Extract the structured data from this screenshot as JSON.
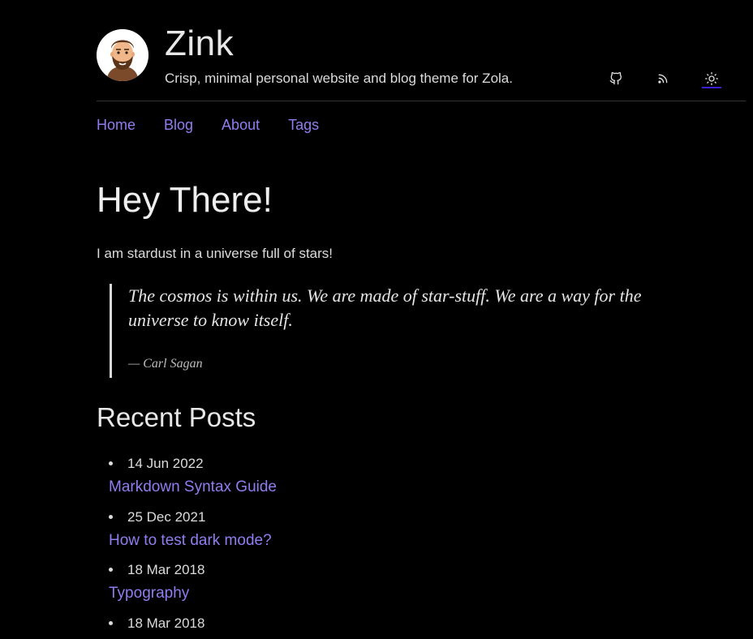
{
  "header": {
    "title": "Zink",
    "tagline": "Crisp, minimal personal website and blog theme for Zola.",
    "icons": [
      "github-icon",
      "rss-icon",
      "sun-icon"
    ],
    "accent_color": "#3b1ed6"
  },
  "nav": {
    "items": [
      {
        "label": "Home"
      },
      {
        "label": "Blog"
      },
      {
        "label": "About"
      },
      {
        "label": "Tags"
      }
    ],
    "link_color": "#8f7ef0"
  },
  "main": {
    "heading": "Hey There!",
    "intro": "I am stardust in a universe full of stars!",
    "quote": {
      "text": "The cosmos is within us. We are made of star-stuff. We are a way for the universe to know itself.",
      "cite": "— Carl Sagan"
    },
    "recent_heading": "Recent Posts",
    "posts": [
      {
        "date": "14 Jun 2022",
        "title": "Markdown Syntax Guide"
      },
      {
        "date": "25 Dec 2021",
        "title": "How to test dark mode?"
      },
      {
        "date": "18 Mar 2018",
        "title": "Typography"
      },
      {
        "date": "18 Mar 2018",
        "title": ""
      }
    ]
  }
}
